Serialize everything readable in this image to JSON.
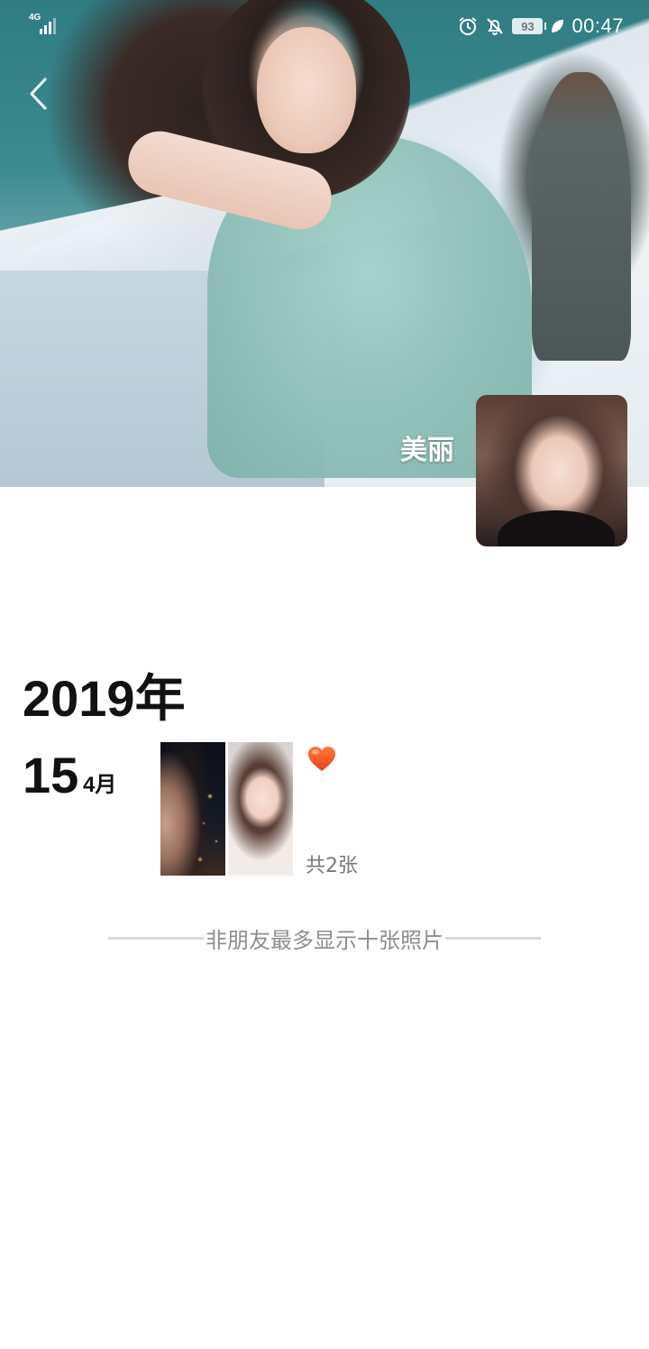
{
  "status_bar": {
    "network": "4G",
    "battery": "93",
    "time": "00:47"
  },
  "profile": {
    "nickname": "美丽"
  },
  "timeline": {
    "year": "2019年",
    "entries": [
      {
        "day": "15",
        "month": "4月",
        "photo_count": "共2张"
      }
    ]
  },
  "footer": {
    "note": "非朋友最多显示十张照片"
  },
  "colors": {
    "heart": "#ff5a1f",
    "muted_text": "#8e8e8e"
  },
  "icons": [
    "back-icon",
    "alarm-icon",
    "mute-bell-icon",
    "battery-icon",
    "leaf-icon",
    "heart-icon",
    "signal-icon"
  ]
}
